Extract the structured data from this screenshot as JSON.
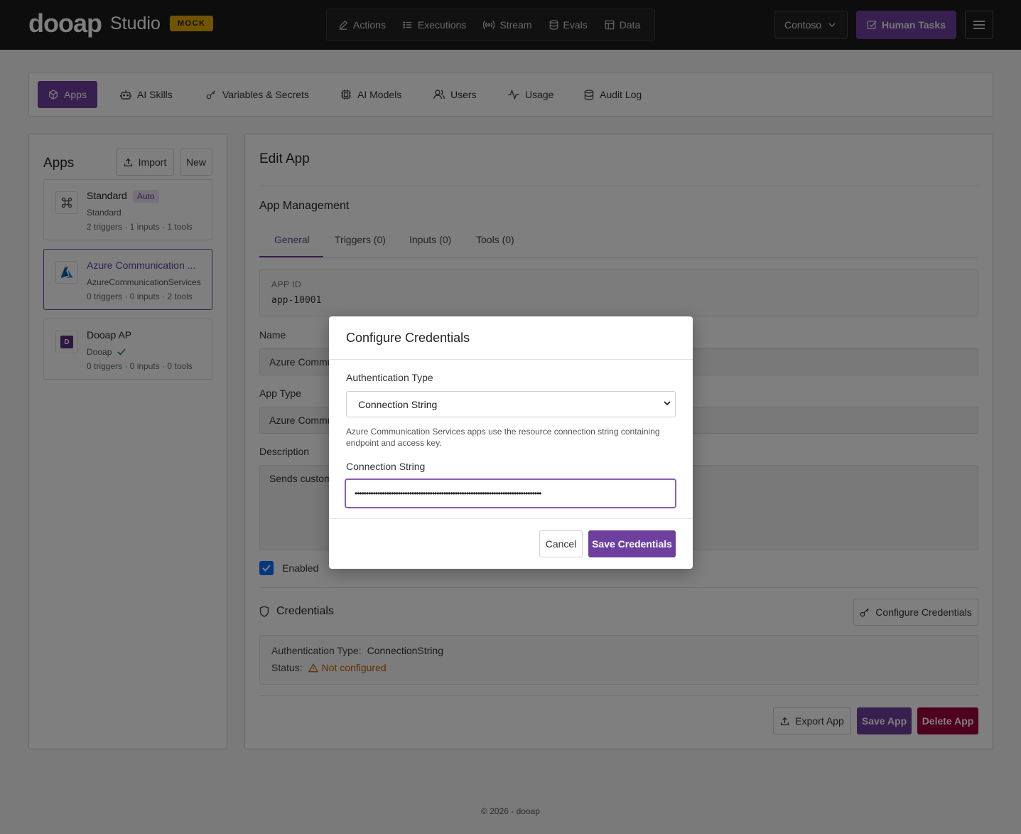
{
  "brand": {
    "logo": "dooap",
    "studio": "Studio",
    "mock": "MOCK"
  },
  "topnav": [
    {
      "label": "Actions",
      "icon": "pencil-icon"
    },
    {
      "label": "Executions",
      "icon": "list-icon"
    },
    {
      "label": "Stream",
      "icon": "broadcast-icon"
    },
    {
      "label": "Evals",
      "icon": "database-icon"
    },
    {
      "label": "Data",
      "icon": "table-icon"
    }
  ],
  "org": {
    "label": "Contoso"
  },
  "human_tasks": {
    "label": "Human Tasks"
  },
  "section_tabs": [
    {
      "label": "Apps",
      "icon": "box-icon",
      "active": true
    },
    {
      "label": "AI Skills",
      "icon": "robot-icon"
    },
    {
      "label": "Variables & Secrets",
      "icon": "key-icon"
    },
    {
      "label": "AI Models",
      "icon": "cpu-icon"
    },
    {
      "label": "Users",
      "icon": "users-icon"
    },
    {
      "label": "Usage",
      "icon": "activity-icon"
    },
    {
      "label": "Audit Log",
      "icon": "database-icon"
    }
  ],
  "sidebar": {
    "title": "Apps",
    "import_label": "Import",
    "new_label": "New",
    "apps": [
      {
        "name": "Standard",
        "badge": "Auto",
        "type": "Standard",
        "meta": "2 triggers · 1 inputs · 1 tools"
      },
      {
        "name": "Azure Communication ...",
        "type": "AzureCommunicationServices",
        "meta": "0 triggers · 0 inputs · 2 tools"
      },
      {
        "name": "Dooap AP",
        "type": "Dooap",
        "meta": "0 triggers · 0 inputs · 0 tools",
        "icon_letter": "D"
      }
    ]
  },
  "main": {
    "title": "Edit App",
    "management_title": "App Management",
    "tabs": [
      "General",
      "Triggers (0)",
      "Inputs (0)",
      "Tools (0)"
    ],
    "app_id_label": "APP ID",
    "app_id": "app-10001",
    "name_label": "Name",
    "name_value": "Azure Commu",
    "type_label": "App Type",
    "type_value": "Azure Commu",
    "description_label": "Description",
    "description_value": "Sends custom",
    "enabled_label": "Enabled",
    "credentials_title": "Credentials",
    "configure_label": "Configure Credentials",
    "auth_type_label": "Authentication Type:",
    "auth_type_value": "ConnectionString",
    "status_label": "Status:",
    "status_value": "Not configured",
    "export_label": "Export App",
    "save_label": "Save App",
    "delete_label": "Delete App"
  },
  "footer": "© 2026 - dooap",
  "modal": {
    "title": "Configure Credentials",
    "auth_label": "Authentication Type",
    "auth_value": "Connection String",
    "help": "Azure Communication Services apps use the resource connection string containing endpoint and access key.",
    "conn_label": "Connection String",
    "conn_value": "••••••••••••••••••••••••••••••••••••••••••••••••••••••••••••••••••••••••••••••••••",
    "cancel_label": "Cancel",
    "save_label": "Save Credentials"
  },
  "colors": {
    "accent": "#6f3f9f",
    "danger": "#a1003f",
    "topbar": "#1b1b1b",
    "warning": "#c45e00"
  }
}
